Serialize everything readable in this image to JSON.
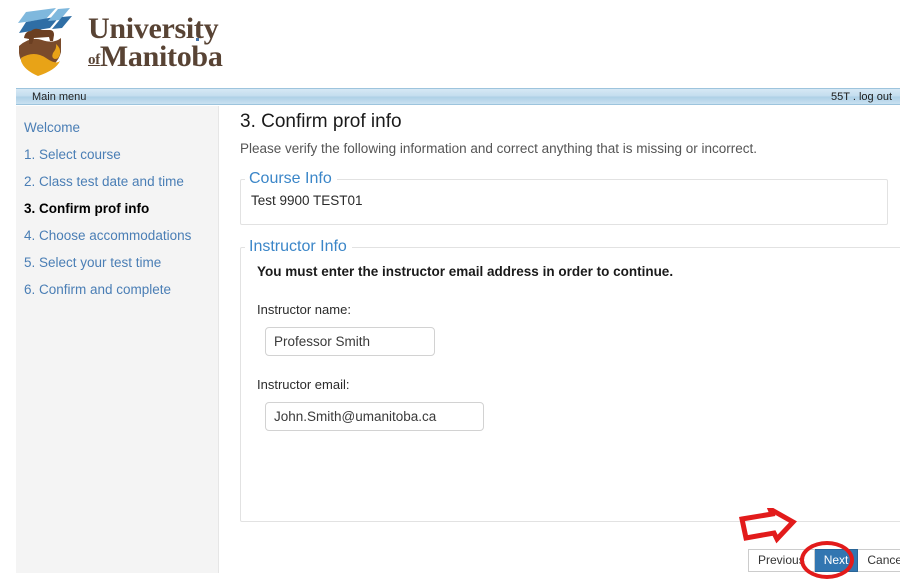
{
  "brand": {
    "logo_icon": "umanitoba-bison-shield-logo",
    "word_top": "University",
    "word_of": "of",
    "word_bottom": "Manitoba"
  },
  "menubar": {
    "main_menu_label": "Main menu",
    "session_and_logout": "55T . log out"
  },
  "sidebar": {
    "items": [
      {
        "label": "Welcome",
        "active": false
      },
      {
        "label": "1. Select course",
        "active": false
      },
      {
        "label": "2. Class test date and time",
        "active": false
      },
      {
        "label": "3. Confirm prof info",
        "active": true
      },
      {
        "label": "4. Choose accommodations",
        "active": false
      },
      {
        "label": "5. Select your test time",
        "active": false
      },
      {
        "label": "6. Confirm and complete",
        "active": false
      }
    ]
  },
  "main": {
    "title": "3. Confirm prof info",
    "subtitle": "Please verify the following information and correct anything that is missing or incorrect.",
    "course_info": {
      "legend": "Course Info",
      "course_line": "Test 9900 TEST01"
    },
    "instructor_info": {
      "legend": "Instructor Info",
      "warning": "You must enter the instructor email address in order to continue.",
      "name_label": "Instructor name:",
      "name_value": "Professor Smith",
      "email_label": "Instructor email:",
      "email_value": "John.Smith@umanitoba.ca"
    }
  },
  "buttons": {
    "previous": "Previous",
    "next": "Next",
    "cancel": "Cancel"
  },
  "annotations": {
    "arrow_icon": "red-arrow-pointing-to-next-button",
    "highlight_icon": "red-ellipse-highlight-on-next-button",
    "color": "#e21b1b"
  },
  "colors": {
    "link_blue": "#4a7eb5",
    "legend_blue": "#3b86c8",
    "primary_button": "#3276b1",
    "sidebar_bg": "#f4f4f4",
    "menubar_blue": "#c3ddee",
    "brand_brown": "#584334",
    "annotation_red": "#e21b1b"
  }
}
